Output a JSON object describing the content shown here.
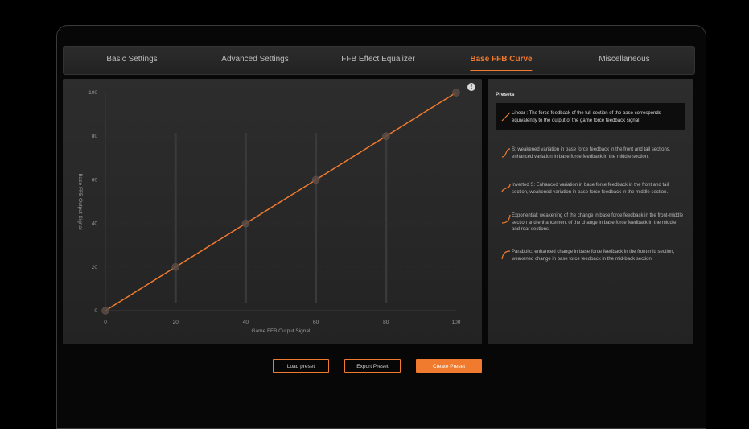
{
  "tabs": [
    {
      "label": "Basic Settings",
      "active": false
    },
    {
      "label": "Advanced Settings",
      "active": false
    },
    {
      "label": "FFB Effect Equalizer",
      "active": false
    },
    {
      "label": "Base FFB Curve",
      "active": true
    },
    {
      "label": "Miscellaneous",
      "active": false
    }
  ],
  "info_icon": "!",
  "chart_data": {
    "type": "line",
    "xlabel": "Game FFB Output Signal",
    "ylabel": "Base FFB Output Signal",
    "x_ticks": [
      "0",
      "20",
      "40",
      "60",
      "80",
      "100"
    ],
    "y_ticks": [
      "0",
      "20",
      "40",
      "60",
      "80",
      "100"
    ],
    "xlim": [
      0,
      100
    ],
    "ylim": [
      0,
      100
    ],
    "series": [
      {
        "x": [
          0,
          20,
          40,
          60,
          80,
          100
        ],
        "y": [
          0,
          20,
          40,
          60,
          80,
          100
        ]
      }
    ],
    "grid": "vertical",
    "line_color": "#f07a2e"
  },
  "presets": {
    "title": "Presets",
    "items": [
      {
        "text": "Linear : The force feedback of the full section of the base corresponds equivalently to the output of the game force feedback signal.",
        "icon": "linear-curve-icon",
        "selected": true
      },
      {
        "text": "S: weakened variation in base force feedback in the front and tail sections, enhanced variation in base force feedback in the middle section.",
        "icon": "s-curve-icon",
        "selected": false
      },
      {
        "text": "Inverted S: Enhanced variation in base force feedback in the front and tail section, weakened variation in base force feedback in the middle section.",
        "icon": "inverted-s-curve-icon",
        "selected": false
      },
      {
        "text": "Exponential: weakening of the change in base force feedback in the front-middle section and enhancement of the change in base force feedback in the middle and rear sections.",
        "icon": "exponential-curve-icon",
        "selected": false
      },
      {
        "text": "Parabolic: enhanced change in base force feedback in the front-mid section, weakened change in base force feedback in the mid-back section.",
        "icon": "parabolic-curve-icon",
        "selected": false
      }
    ]
  },
  "buttons": {
    "load": "Load preset",
    "export": "Export Preset",
    "create": "Create Preset"
  },
  "colors": {
    "accent": "#f07a2e",
    "panel": "#2a2a2a",
    "background": "#000000"
  }
}
